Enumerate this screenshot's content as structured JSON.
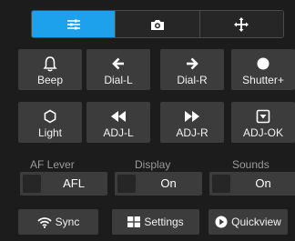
{
  "tabs": [
    {
      "icon": "sliders-icon",
      "active": true
    },
    {
      "icon": "camera-icon",
      "active": false
    },
    {
      "icon": "move-icon",
      "active": false
    }
  ],
  "grid": {
    "row1": [
      {
        "label": "Beep",
        "icon": "bell-icon"
      },
      {
        "label": "Dial-L",
        "icon": "arrow-left-icon"
      },
      {
        "label": "Dial-R",
        "icon": "arrow-right-icon"
      },
      {
        "label": "Shutter+",
        "icon": "circle-icon"
      }
    ],
    "row2": [
      {
        "label": "Light",
        "icon": "light-icon"
      },
      {
        "label": "ADJ-L",
        "icon": "rewind-icon"
      },
      {
        "label": "ADJ-R",
        "icon": "fast-forward-icon"
      },
      {
        "label": "ADJ-OK",
        "icon": "select-box-icon"
      }
    ]
  },
  "toggles": [
    {
      "label": "AF Lever",
      "value": "AFL"
    },
    {
      "label": "Display",
      "value": "On"
    },
    {
      "label": "Sounds",
      "value": "On"
    }
  ],
  "actions": [
    {
      "label": "Sync",
      "icon": "wifi-icon"
    },
    {
      "label": "Settings",
      "icon": "grid-icon"
    },
    {
      "label": "Quickview",
      "icon": "play-circle-icon"
    }
  ],
  "colors": {
    "accent": "#1da1ec",
    "background": "#1c1c1c",
    "button": "#3c3c3c",
    "muted_text": "#9a9a9a"
  }
}
